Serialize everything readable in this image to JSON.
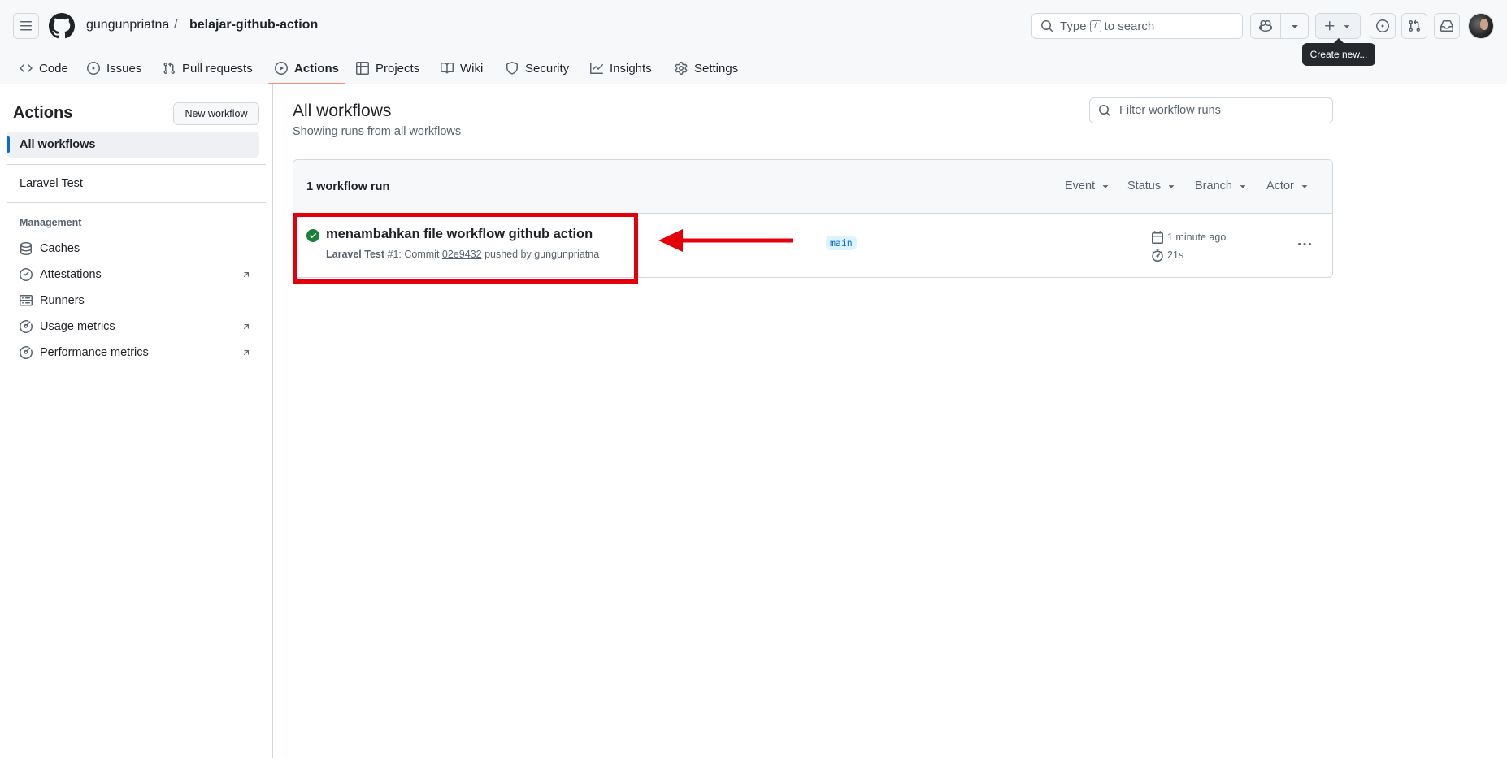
{
  "header": {
    "owner": "gungunpriatna",
    "separator": "/",
    "repo": "belajar-github-action",
    "search_prefix": "Type",
    "search_key": "/",
    "search_suffix": "to search",
    "tooltip": "Create new..."
  },
  "nav": {
    "tabs": [
      {
        "label": "Code",
        "icon": "code-icon"
      },
      {
        "label": "Issues",
        "icon": "issue-opened-icon"
      },
      {
        "label": "Pull requests",
        "icon": "git-pull-request-icon"
      },
      {
        "label": "Actions",
        "icon": "play-icon",
        "active": true
      },
      {
        "label": "Projects",
        "icon": "table-icon"
      },
      {
        "label": "Wiki",
        "icon": "book-icon"
      },
      {
        "label": "Security",
        "icon": "shield-icon"
      },
      {
        "label": "Insights",
        "icon": "graph-icon"
      },
      {
        "label": "Settings",
        "icon": "gear-icon"
      }
    ]
  },
  "sidebar": {
    "title": "Actions",
    "new_workflow": "New workflow",
    "all_workflows": "All workflows",
    "workflows": [
      "Laravel Test"
    ],
    "management_heading": "Management",
    "management": [
      {
        "label": "Caches",
        "icon": "database-icon"
      },
      {
        "label": "Attestations",
        "icon": "verified-icon",
        "external": true
      },
      {
        "label": "Runners",
        "icon": "server-icon"
      },
      {
        "label": "Usage metrics",
        "icon": "meter-icon",
        "external": true
      },
      {
        "label": "Performance metrics",
        "icon": "meter-icon",
        "external": true
      }
    ]
  },
  "main": {
    "title": "All workflows",
    "subtitle": "Showing runs from all workflows",
    "filter_placeholder": "Filter workflow runs",
    "run_count": "1 workflow run",
    "filters": [
      "Event",
      "Status",
      "Branch",
      "Actor"
    ],
    "runs": [
      {
        "title": "menambahkan file workflow github action",
        "workflow": "Laravel Test",
        "number": "#1",
        "commit_prefix": ": Commit",
        "sha": "02e9432",
        "pushed_by": "pushed by gungunpriatna",
        "branch": "main",
        "time_ago": "1 minute ago",
        "duration": "21s",
        "status": "success"
      }
    ]
  },
  "colors": {
    "accent": "#0969da",
    "tab_underline": "#fd8c73",
    "success": "#1a7f37",
    "annotation": "#e3000b"
  }
}
